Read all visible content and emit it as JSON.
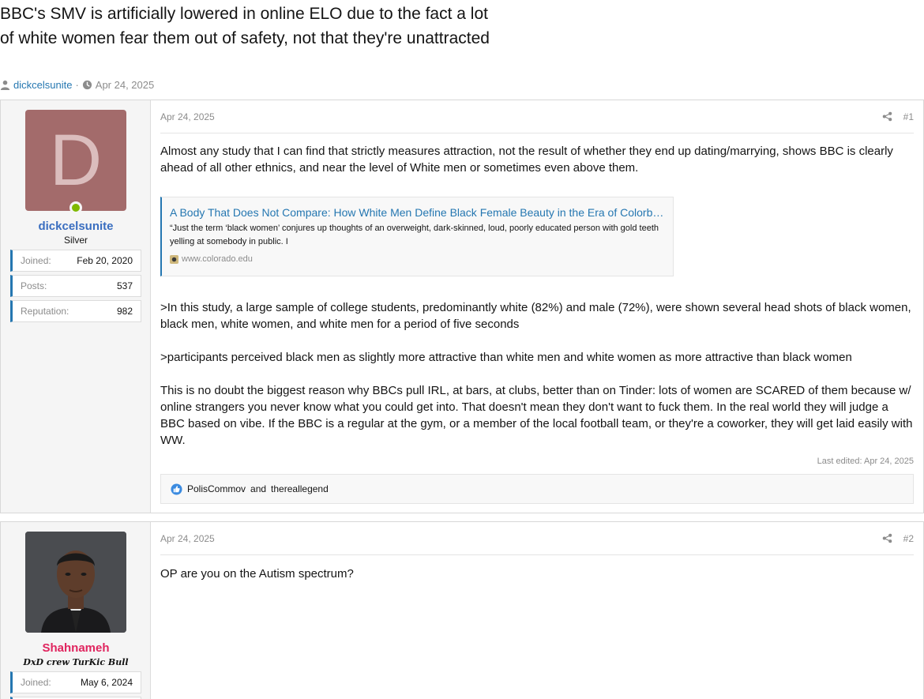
{
  "thread": {
    "title": "BBC's SMV is artificially lowered in online ELO due to the fact a lot of white women fear them out of safety, not that they're unattracted",
    "author": "dickcelsunite",
    "separator": "·",
    "date": "Apr 24, 2025"
  },
  "posts": [
    {
      "user": {
        "avatar_letter": "D",
        "avatar_color": "#a36b6b",
        "online": true,
        "name": "dickcelsunite",
        "name_color": "#3a6ec0",
        "title": "Silver",
        "joined_label": "Joined:",
        "joined": "Feb 20, 2020",
        "posts_label": "Posts:",
        "posts": "537",
        "rep_label": "Reputation:",
        "rep": "982"
      },
      "date": "Apr 24, 2025",
      "number": "#1",
      "paragraph1": "Almost any study that I can find that strictly measures attraction, not the result of whether they end up dating/marrying, shows BBC is clearly ahead of all other ethnics, and near the level of White men or sometimes even above them.",
      "embed": {
        "title": "A Body That Does Not Compare: How White Men Define Black Female Beauty in the Era of Colorblindness",
        "description": "“Just the term ‘black women’ conjures up thoughts of an overweight, dark-skinned, loud, poorly educated person with gold teeth yelling at somebody in public. I",
        "site": "www.colorado.edu"
      },
      "paragraph2": ">In this study, a large sample of college students, predominantly white (82%) and male (72%), were shown several head shots of black women, black men, white women, and white men for a period of five seconds",
      "paragraph3": ">participants perceived black men as slightly more attractive than white men and white women as more attractive than black women",
      "paragraph4": "This is no doubt the biggest reason why BBCs pull IRL, at bars, at clubs, better than on Tinder: lots of women are SCARED of them because w/ online strangers you never know what you could get into. That doesn't mean they don't want to fuck them. In the real world they will judge a BBC based on vibe. If the BBC is a regular at the gym, or a member of the local football team, or they're a coworker, they will get laid easily with WW.",
      "last_edited": "Last edited: Apr 24, 2025",
      "reaction_user1": "PolisCommov",
      "reaction_and": "and",
      "reaction_user2": "thereallegend"
    },
    {
      "user": {
        "name": "Shahnameh",
        "name_color": "#e0245e",
        "title": "DxD crew TurKic Bull",
        "joined_label": "Joined:",
        "joined": "May 6, 2024"
      },
      "date": "Apr 24, 2025",
      "number": "#2",
      "paragraph1": "OP are you on the Autism spectrum?"
    }
  ]
}
